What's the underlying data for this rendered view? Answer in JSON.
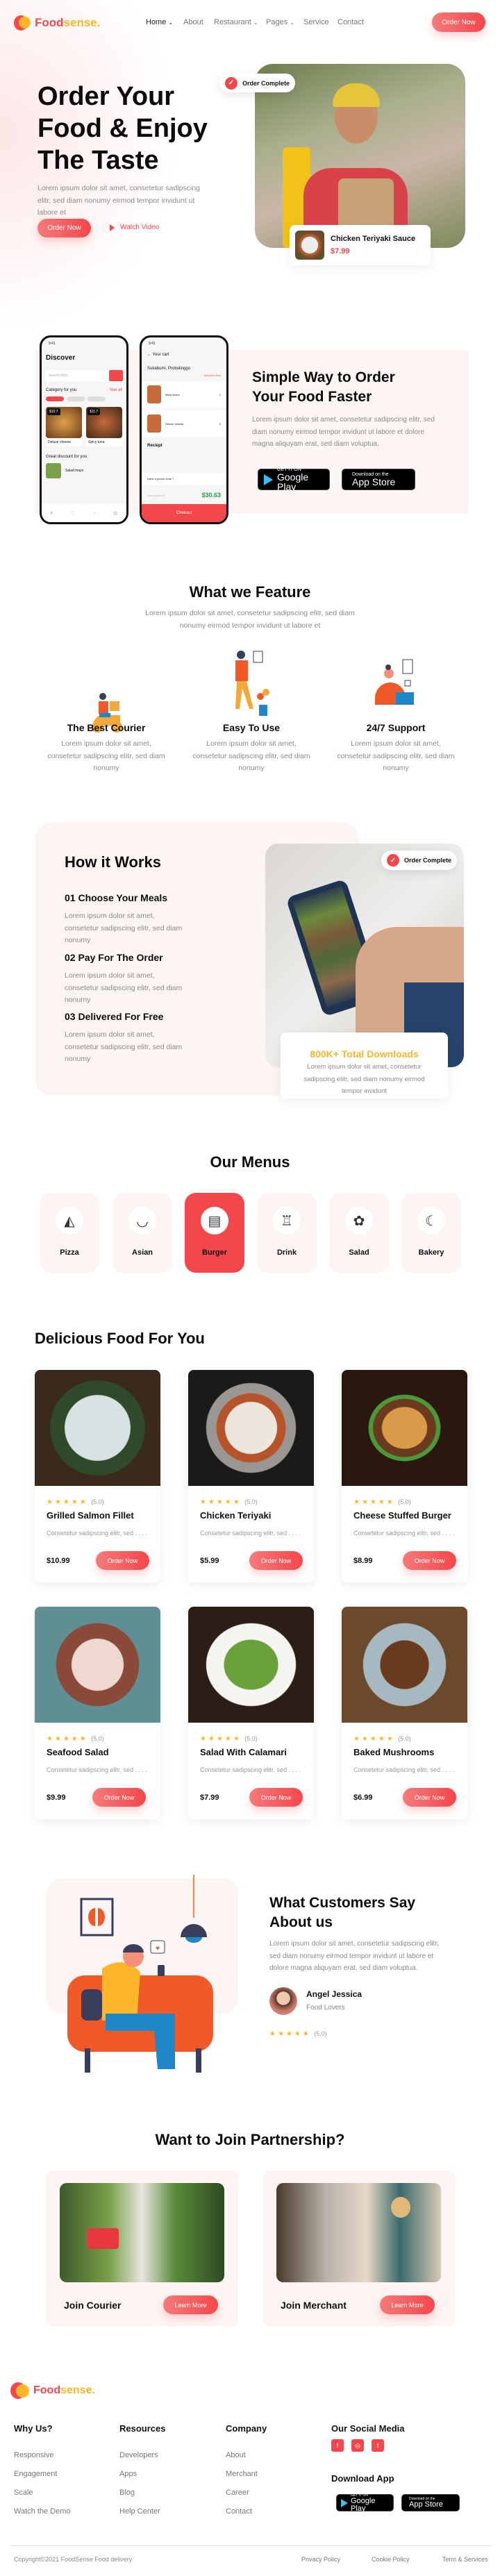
{
  "colors": {
    "accent": "#f4474b",
    "yellow": "#fdb52a",
    "pink_bg": "#fdf5f3"
  },
  "brand": {
    "name_part1": "Food",
    "name_part2": "sense."
  },
  "nav": {
    "items": [
      {
        "label": "Home",
        "dropdown": true,
        "active": true
      },
      {
        "label": "About"
      },
      {
        "label": "Restaurant",
        "dropdown": true
      },
      {
        "label": "Pages",
        "dropdown": true
      },
      {
        "label": "Service"
      },
      {
        "label": "Contact"
      }
    ],
    "cta": "Order Now"
  },
  "hero": {
    "title_lines": [
      "Order Your",
      "Food & Enjoy",
      "The Taste"
    ],
    "text": "Lorem ipsum dolor sit amet, consetetur sadipscing elitr, sed diam nonumy eirmod tempor invidunt ut labore et",
    "order_btn": "Order Now",
    "video_btn": "Watch Video",
    "badge": "Order Complete",
    "dish_name": "Chicken Teriyaki Sauce",
    "dish_price": "$7.99"
  },
  "app": {
    "title_lines": [
      "Simple Way to Order",
      "Your Food Faster"
    ],
    "text": "Lorem ipsum dolor sit amet, consetetur sadipscing elitr, sed diam nonumy eirmod tempor invidunt ut labore et dolore magna aliquyam erat, sed diam voluptua.",
    "google_small": "GET IT ON",
    "google_big": "Google Play",
    "apple_small": "Download on the",
    "apple_big": "App Store",
    "phone1": {
      "time": "9:41",
      "title": "Discover",
      "search": "Search food ...",
      "category": "Category for you",
      "see_all": "See all",
      "items": [
        "Deluxe cheese",
        "Spicy tuna"
      ],
      "prices": [
        "$10.7",
        "$11.7"
      ],
      "discount": "Great discount for you",
      "discount_item": "Salad mayo"
    },
    "phone2": {
      "time": "9:41",
      "title": "Your cart",
      "address": "Sukabumi, Probolinggo",
      "add_item": "Add new item",
      "items": [
        "Meat lovers",
        "Deluxe cheese"
      ],
      "qty": [
        "1",
        "2"
      ],
      "receipt": "Reciept",
      "promo": "Have a promo code ?",
      "total_label": "Total payment",
      "total": "$30.63",
      "checkout": "Chekout"
    }
  },
  "features": {
    "title": "What we Feature",
    "text": "Lorem ipsum dolor sit amet, consetetur sadipscing elitr, sed diam nonumy eirmod tempor invidunt ut labore et",
    "items": [
      {
        "title": "The Best Courier",
        "text": "Lorem ipsum dolor sit amet, consetetur sadipscing elitr, sed diam nonumy",
        "icon": "courier-scooter-illustration"
      },
      {
        "title": "Easy To Use",
        "text": "Lorem ipsum dolor sit amet, consetetur sadipscing elitr, sed diam nonumy",
        "icon": "person-phone-illustration"
      },
      {
        "title": "24/7 Support",
        "text": "Lorem ipsum dolor sit amet, consetetur sadipscing elitr, sed diam nonumy",
        "icon": "support-laptop-illustration"
      }
    ]
  },
  "how": {
    "title": "How it Works",
    "steps": [
      {
        "title": "01 Choose Your Meals",
        "text": "Lorem ipsum dolor sit amet, consetetur sadipscing elitr, sed diam nonumy"
      },
      {
        "title": "02 Pay For The Order",
        "text": "Lorem ipsum dolor sit amet, consetetur sadipscing elitr, sed diam nonumy"
      },
      {
        "title": "03 Delivered For Free",
        "text": "Lorem ipsum dolor sit amet, consetetur sadipscing elitr, sed diam nonumy"
      }
    ],
    "badge": "Order Complete",
    "downloads_title": "800K+ Total Downloads",
    "downloads_text": "Lorem ipsum dolor sit amet, consetetur sadipscing elitr, sed diam nonumy eirmod tempor invidunt"
  },
  "menus": {
    "title": "Our Menus",
    "items": [
      {
        "label": "Pizza",
        "icon": "pizza-icon"
      },
      {
        "label": "Asian",
        "icon": "rice-bowl-icon"
      },
      {
        "label": "Burger",
        "icon": "burger-icon",
        "active": true
      },
      {
        "label": "Drink",
        "icon": "drink-icon"
      },
      {
        "label": "Salad",
        "icon": "salad-icon"
      },
      {
        "label": "Bakery",
        "icon": "croissant-icon"
      }
    ]
  },
  "foods": {
    "title": "Delicious Food For You",
    "items": [
      {
        "name": "Grilled Salmon Fillet",
        "price": "$10.99",
        "rating": "(5.0)",
        "stars": 5,
        "desc": "Consetetur sadipscing elitr, sed . . . .",
        "btn": "Order Now"
      },
      {
        "name": "Chicken Teriyaki",
        "price": "$5.99",
        "rating": "(5.0)",
        "stars": 5,
        "desc": "Consetetur sadipscing elitr, sed . . . .",
        "btn": "Order Now"
      },
      {
        "name": "Cheese Stuffed Burger",
        "price": "$8.99",
        "rating": "(5.0)",
        "stars": 5,
        "desc": "Consetetur sadipscing elitr, sed . . . .",
        "btn": "Order Now"
      },
      {
        "name": "Seafood Salad",
        "price": "$9.99",
        "rating": "(5.0)",
        "stars": 5,
        "desc": "Consetetur sadipscing elitr, sed . . . .",
        "btn": "Order Now"
      },
      {
        "name": "Salad With Calamari",
        "price": "$7.99",
        "rating": "(5.0)",
        "stars": 5,
        "desc": "Consetetur sadipscing elitr, sed . . . .",
        "btn": "Order Now"
      },
      {
        "name": "Baked Mushrooms",
        "price": "$6.99",
        "rating": "(5.0)",
        "stars": 5,
        "desc": "Consetetur sadipscing elitr, sed . . . .",
        "btn": "Order Now"
      }
    ]
  },
  "testimonial": {
    "title_lines": [
      "What Customers Say",
      "About us"
    ],
    "text": "Lorem ipsum dolor sit amet, consetetur sadipscing elitr, sed diam nonumy eirmod tempor invidunt ut labore et dolore magna aliquyam erat, sed diam voluptua.",
    "name": "Angel Jessica",
    "role": "Food Lovers",
    "rating": "(5.0)",
    "stars": 5
  },
  "partner": {
    "title": "Want to Join Partnership?",
    "cards": [
      {
        "label": "Join Courier",
        "btn": "Learn More"
      },
      {
        "label": "Join Merchant",
        "btn": "Learn More"
      }
    ]
  },
  "footer": {
    "columns": [
      {
        "title": "Why Us?",
        "links": [
          "Responsive",
          "Engagement",
          "Scale",
          "Watch the Demo"
        ]
      },
      {
        "title": "Resources",
        "links": [
          "Developers",
          "Apps",
          "Blog",
          "Help Center"
        ]
      },
      {
        "title": "Company",
        "links": [
          "About",
          "Merchant",
          "Career",
          "Contact"
        ]
      }
    ],
    "social_title": "Our Social Media",
    "social": [
      "facebook-icon",
      "instagram-icon",
      "twitter-icon"
    ],
    "download_title": "Download App",
    "copyright": "Copyright©2021 FoodSense Food delivery",
    "legal": [
      "Privacy Policy",
      "Cookie Policy",
      "Term & Services"
    ]
  }
}
